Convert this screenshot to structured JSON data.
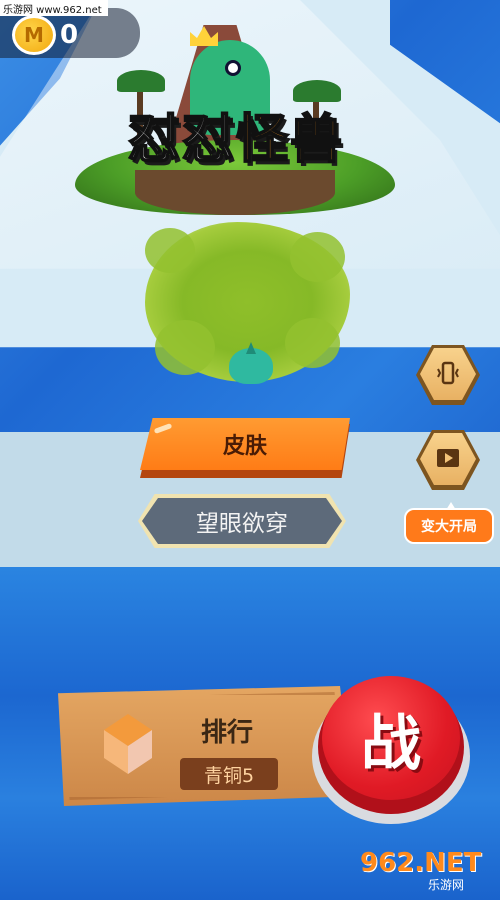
{
  "watermark": {
    "top_text": "乐游网 www.962.net",
    "bottom_logo": "962.NET",
    "bottom_sub": "乐游网"
  },
  "coins": {
    "icon_letter": "M",
    "count": "0"
  },
  "logo": {
    "title_chars": [
      "怼",
      "怼",
      "怪",
      "兽"
    ]
  },
  "skin_button": {
    "label": "皮肤"
  },
  "status": {
    "text": "望眼欲穿"
  },
  "side_buttons": {
    "vibrate_icon": "phone-vibrate-icon",
    "video_icon": "video-play-icon",
    "big_start_label": "变大开局"
  },
  "rank": {
    "title": "排行",
    "tier": "青铜5"
  },
  "fight_button": {
    "label": "战"
  },
  "colors": {
    "ocean": "#1e68d2",
    "ice": "#d7ebf6",
    "orange_button": "#ff7c16",
    "fight_red": "#e01a25",
    "wood": "#d99656"
  }
}
